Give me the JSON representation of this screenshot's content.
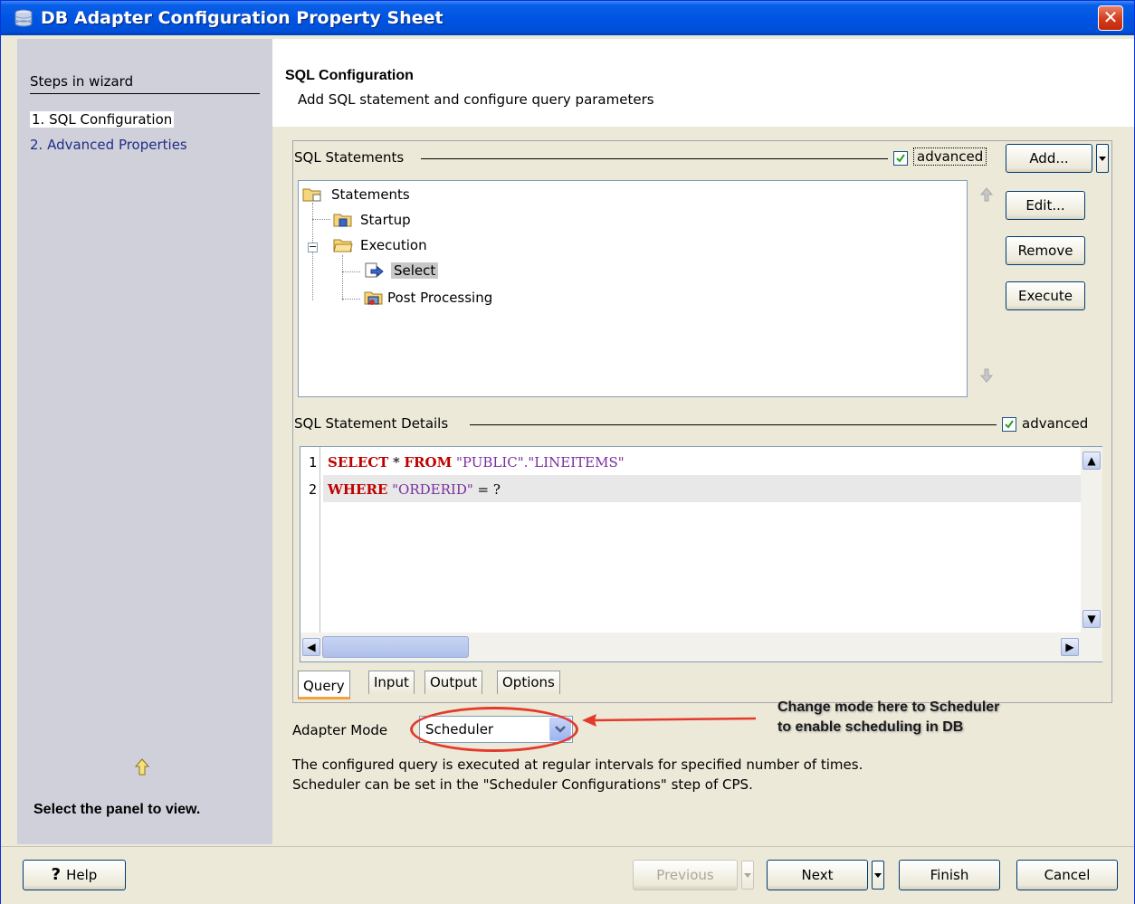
{
  "window": {
    "title": "DB Adapter Configuration Property Sheet",
    "close_glyph": "✕"
  },
  "sidebar": {
    "steps_title": "Steps in wizard",
    "steps": [
      {
        "label": "1. SQL Configuration",
        "active": true
      },
      {
        "label": "2. Advanced Properties",
        "active": false
      }
    ],
    "hint_text": "Select the panel to view."
  },
  "header": {
    "title": "SQL Configuration",
    "subtitle": "Add SQL statement and configure query parameters"
  },
  "sql_statements": {
    "group_label": "SQL Statements",
    "advanced_label": "advanced",
    "advanced_checked": true,
    "buttons": {
      "add": "Add...",
      "edit": "Edit...",
      "remove": "Remove",
      "execute": "Execute"
    },
    "tree": {
      "root": "Statements",
      "startup": "Startup",
      "execution": "Execution",
      "select": "Select",
      "post_processing": "Post Processing"
    }
  },
  "details": {
    "group_label": "SQL Statement Details",
    "advanced_label": "advanced",
    "advanced_checked": true,
    "line_numbers": [
      "1",
      "2"
    ],
    "line1": {
      "kw1": "SELECT",
      "op": " * ",
      "kw2": "FROM",
      "str": " \"PUBLIC\".\"LINEITEMS\""
    },
    "line2": {
      "kw": "WHERE",
      "str": " \"ORDERID\"",
      "rest": " = ?"
    },
    "tabs": [
      "Query",
      "Input",
      "Output",
      "Options"
    ],
    "active_tab": "Query"
  },
  "adapter_mode": {
    "label": "Adapter Mode",
    "value": "Scheduler"
  },
  "annotation": {
    "line1": "Change mode here to Scheduler",
    "line2": "to enable scheduling in DB",
    "color": "#e43a2c"
  },
  "description": {
    "line1": "The configured query is executed at regular intervals for specified number of times.",
    "line2": "Scheduler can be set in the \"Scheduler Configurations\" step of CPS."
  },
  "footer": {
    "help": "Help",
    "previous": "Previous",
    "next": "Next",
    "finish": "Finish",
    "cancel": "Cancel"
  }
}
